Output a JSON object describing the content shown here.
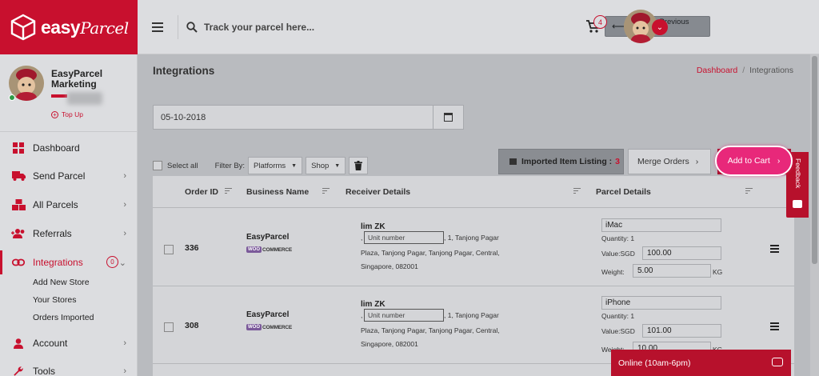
{
  "brand": {
    "name": "easy",
    "name_script": "Parcel"
  },
  "header": {
    "search_placeholder": "Track your parcel here...",
    "back_button": "Back to Previous Version",
    "cart_count": "4"
  },
  "profile": {
    "name": "EasyParcel Marketing",
    "topup": "Top Up"
  },
  "sidebar": {
    "items": [
      {
        "label": "Dashboard"
      },
      {
        "label": "Send Parcel"
      },
      {
        "label": "All Parcels"
      },
      {
        "label": "Referrals"
      },
      {
        "label": "Integrations",
        "badge": "0"
      },
      {
        "label": "Account"
      },
      {
        "label": "Tools"
      }
    ],
    "subitems": [
      "Add New Store",
      "Your Stores",
      "Orders Imported"
    ]
  },
  "page": {
    "title": "Integrations",
    "breadcrumb": {
      "home": "Dashboard",
      "current": "Integrations"
    },
    "date": "05-10-2018"
  },
  "toolbar": {
    "select_all": "Select all",
    "filter_by": "Filter By:",
    "platforms": "Platforms",
    "shop": "Shop",
    "imported_label": "Imported Item Listing :",
    "imported_count": "3",
    "merge": "Merge Orders",
    "add_to_cart": "Add to Cart"
  },
  "table": {
    "headers": [
      "Order ID",
      "Business Name",
      "Receiver Details",
      "Parcel Details"
    ],
    "unit_placeholder": "Unit number",
    "rows": [
      {
        "order_id": "336",
        "business": "EasyParcel",
        "platform": "WOO COMMERCE",
        "receiver": "lim ZK",
        "addr1_prefix": ",",
        "addr1_suffix": ", 1, Tanjong Pagar",
        "addr2": "Plaza, Tanjong Pagar, Tanjong Pagar, Central,",
        "addr3": "Singapore, 082001",
        "item": "iMac",
        "quantity": "Quantity: 1",
        "value_label": "Value:SGD",
        "value": "100.00",
        "weight_label": "Weight:",
        "weight": "5.00",
        "weight_unit": "KG"
      },
      {
        "order_id": "308",
        "business": "EasyParcel",
        "platform": "WOO COMMERCE",
        "receiver": "lim ZK",
        "addr1_prefix": ",",
        "addr1_suffix": ", 1, Tanjong Pagar",
        "addr2": "Plaza, Tanjong Pagar, Tanjong Pagar, Central,",
        "addr3": "Singapore, 082001",
        "item": "iPhone",
        "quantity": "Quantity: 1",
        "value_label": "Value:SGD",
        "value": "101.00",
        "weight_label": "Weight:",
        "weight": "10.00",
        "weight_unit": "KG"
      }
    ]
  },
  "feedback": "Feedback",
  "chat": "Online (10am-6pm)",
  "colors": {
    "brand_red": "#c8102e",
    "cart_pink": "#e8287a",
    "overlay_gray": "#b9bbbf"
  }
}
